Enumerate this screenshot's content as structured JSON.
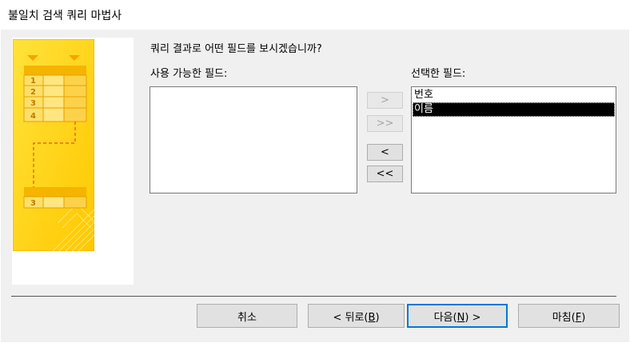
{
  "window": {
    "title": "불일치 검색 쿼리 마법사"
  },
  "page": {
    "question": "쿼리 결과로 어떤 필드를 보시겠습니까?",
    "available_label": "사용 가능한 필드:",
    "selected_label": "선택한 필드:"
  },
  "available_fields": [],
  "selected_fields": [
    {
      "label": "번호",
      "selected": false
    },
    {
      "label": "이름",
      "selected": true
    }
  ],
  "move_buttons": {
    "add_one": ">",
    "add_all": ">>",
    "remove_one": "<",
    "remove_all": "<<"
  },
  "illustration": {
    "top_rows": [
      "1",
      "2",
      "3",
      "4"
    ],
    "bottom_row": "3"
  },
  "footer": {
    "cancel": "취소",
    "back_prefix": "< 뒤로(",
    "back_key": "B",
    "back_suffix": ")",
    "next_prefix": "다음(",
    "next_key": "N",
    "next_suffix": ") >",
    "finish_prefix": "마침(",
    "finish_key": "F",
    "finish_suffix": ")"
  },
  "colors": {
    "illustration_yellow": "#ffd200",
    "illustration_orange": "#f5a300",
    "default_button_border": "#0078d7",
    "selection": "#000000"
  }
}
